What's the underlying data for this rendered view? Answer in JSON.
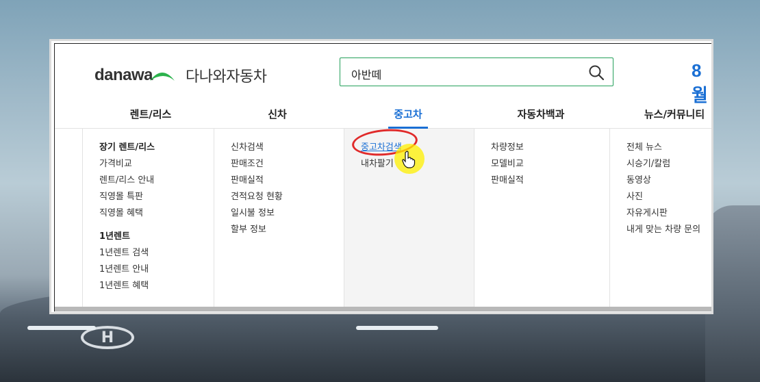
{
  "header": {
    "logo_word": "danawa",
    "logo_sub": "다나와자동차",
    "search_value": "아반떼",
    "promo_text": "8월"
  },
  "nav": {
    "items": [
      {
        "label": "렌트/리스"
      },
      {
        "label": "신차"
      },
      {
        "label": "중고차"
      },
      {
        "label": "자동차백과"
      },
      {
        "label": "뉴스/커뮤니티"
      }
    ],
    "active": "중고차"
  },
  "menu": {
    "rent": {
      "head1": "장기 렌트/리스",
      "items1": [
        "가격비교",
        "렌트/리스 안내",
        "직영몰 특판",
        "직영몰 혜택"
      ],
      "head2": "1년렌트",
      "items2": [
        "1년렌트 검색",
        "1년렌트 안내",
        "1년렌트 혜택"
      ]
    },
    "new": {
      "items": [
        "신차검색",
        "판매조건",
        "판매실적",
        "견적요청 현황",
        "일시불 정보",
        "할부 정보"
      ]
    },
    "used": {
      "items": [
        "중고차검색",
        "내차팔기"
      ]
    },
    "encyclopedia": {
      "items": [
        "차량정보",
        "모델비교",
        "판매실적"
      ]
    },
    "news": {
      "items": [
        "전체 뉴스",
        "시승기/칼럼",
        "동영상",
        "사진",
        "자유게시판",
        "내게 맞는 차량 문의"
      ]
    }
  },
  "colors": {
    "accent": "#1a6fd4",
    "search_border": "#23a05a",
    "logo_green": "#2bb24c",
    "highlight": "#e02a2a"
  },
  "icons": {
    "search": "search-icon",
    "cursor": "hand-pointer-icon"
  }
}
